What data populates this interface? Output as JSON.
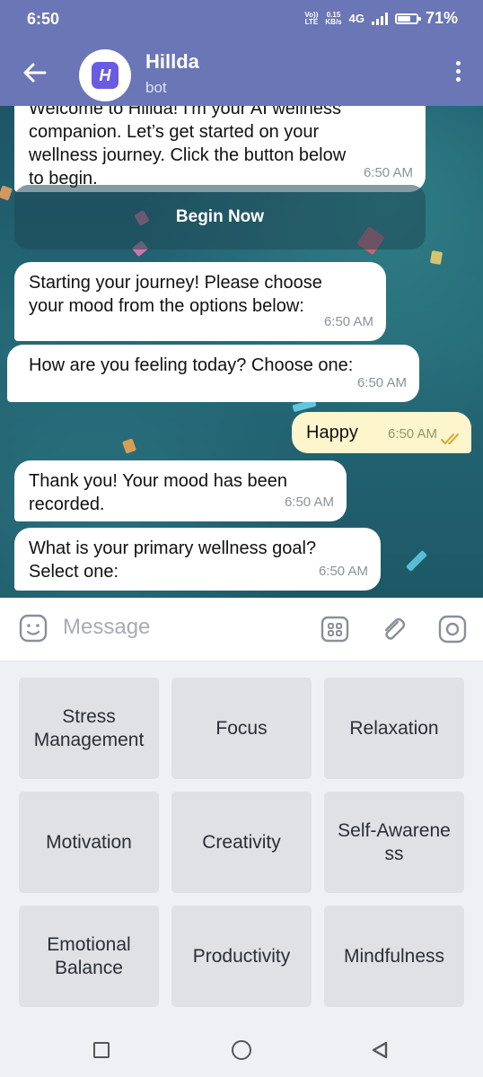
{
  "status_bar": {
    "time": "6:50",
    "volte": "Vo))",
    "lte": "LTE",
    "speed_value": "0.15",
    "speed_unit": "KB/s",
    "network": "4G",
    "battery_percent": "71%",
    "battery_level": 0.71
  },
  "header": {
    "title": "Hillda",
    "subtitle": "bot",
    "avatar_glyph": "H",
    "back_icon": "arrow-left-icon",
    "menu_icon": "more-vertical-icon"
  },
  "messages": [
    {
      "direction": "in",
      "text": "Welcome to Hillda! I'm your AI wellness\ncompanion. Let’s get started on your\nwellness journey. Click the button below\nto begin.",
      "time": "6:50 AM"
    },
    {
      "direction": "in",
      "text": "Starting your journey! Please choose\nyour mood from the options below:",
      "time": "6:50 AM"
    },
    {
      "direction": "in",
      "text": "How are you feeling today? Choose one:",
      "time": "6:50 AM"
    },
    {
      "direction": "out",
      "text": "Happy",
      "time": "6:50 AM",
      "status": "read"
    },
    {
      "direction": "in",
      "text": "Thank you! Your mood has been\nrecorded.",
      "time": "6:50 AM"
    },
    {
      "direction": "in",
      "text": "What is your primary wellness goal?\nSelect one:",
      "time": "6:50 AM"
    }
  ],
  "inline_button": {
    "label": "Begin Now"
  },
  "composer": {
    "placeholder": "Message",
    "icons": [
      "sticker-icon",
      "bot-keyboard-icon",
      "attach-icon",
      "camera-icon"
    ]
  },
  "keyboard": {
    "options": [
      "Stress\nManagement",
      "Focus",
      "Relaxation",
      "Motivation",
      "Creativity",
      "Self-Awarene\nss",
      "Emotional\nBalance",
      "Productivity",
      "Mindfulness"
    ]
  },
  "nav_bar": {
    "icons": [
      "recents-square-icon",
      "home-circle-icon",
      "back-triangle-icon"
    ]
  },
  "colors": {
    "header": "#6a76b5",
    "outgoing_bubble": "#fdf5cb",
    "key_bg": "#dfe1e5",
    "chat_bg": "#246876"
  }
}
